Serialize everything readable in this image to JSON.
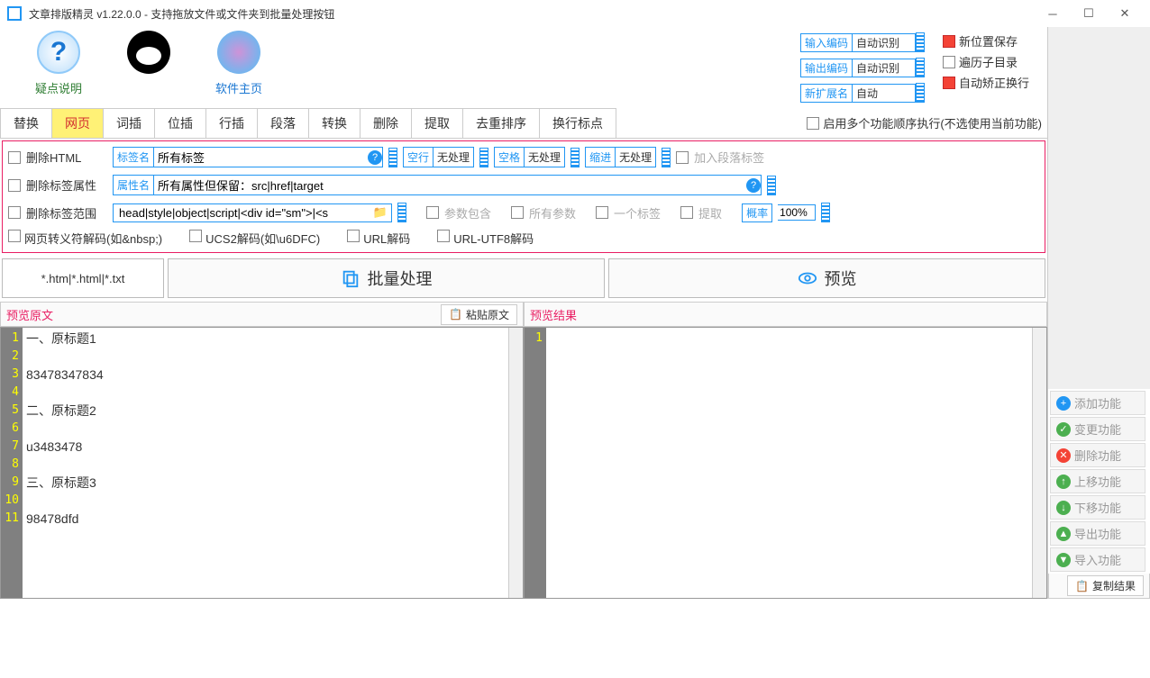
{
  "titlebar": "文章排版精灵  v1.22.0.0 - 支持拖放文件或文件夹到批量处理按钮",
  "topicons": {
    "help": "疑点说明",
    "home": "软件主页"
  },
  "settings": {
    "input_enc_label": "输入编码",
    "input_enc_val": "自动识别",
    "output_enc_label": "输出编码",
    "output_enc_val": "自动识别",
    "ext_label": "新扩展名",
    "ext_val": "自动",
    "newpos": "新位置保存",
    "traverse": "遍历子目录",
    "autofix": "自动矫正换行"
  },
  "tabs": [
    "替换",
    "网页",
    "词插",
    "位插",
    "行插",
    "段落",
    "转换",
    "删除",
    "提取",
    "去重排序",
    "换行标点"
  ],
  "enable_func": "启用多个功能顺序执行(不选使用当前功能)",
  "opts": {
    "del_html": "删除HTML",
    "tag_label": "标签名",
    "tag_val": "所有标签",
    "blank_label": "空行",
    "blank_val": "无处理",
    "space_label": "空格",
    "space_val": "无处理",
    "indent_label": "缩进",
    "indent_val": "无处理",
    "add_para": "加入段落标签",
    "del_attr": "删除标签属性",
    "attr_label": "属性名",
    "attr_val": "所有属性但保留：src|href|target",
    "del_range": "删除标签范围",
    "range_val": "head|style|object|script|<div id=\"sm\">|<s",
    "param_contain": "参数包含",
    "all_param": "所有参数",
    "one_tag": "一个标签",
    "extract": "提取",
    "prob_label": "概率",
    "prob_val": "100%",
    "esc_decode": "网页转义符解码(如&nbsp;)",
    "ucs2": "UCS2解码(如\\u6DFC)",
    "url_decode": "URL解码",
    "url_utf8": "URL-UTF8解码"
  },
  "filter": "*.htm|*.html|*.txt",
  "batch": "批量处理",
  "preview_btn": "预览",
  "funcs": {
    "add": "添加功能",
    "change": "变更功能",
    "del": "删除功能",
    "up": "上移功能",
    "down": "下移功能",
    "export": "导出功能",
    "import": "导入功能"
  },
  "src_title": "预览原文",
  "paste": "粘贴原文",
  "res_title": "预览结果",
  "copy": "复制结果",
  "src_lines": [
    "一、原标题1",
    "",
    "83478347834",
    "",
    "二、原标题2",
    "",
    "u3483478",
    "",
    "三、原标题3",
    "",
    "98478dfd"
  ]
}
